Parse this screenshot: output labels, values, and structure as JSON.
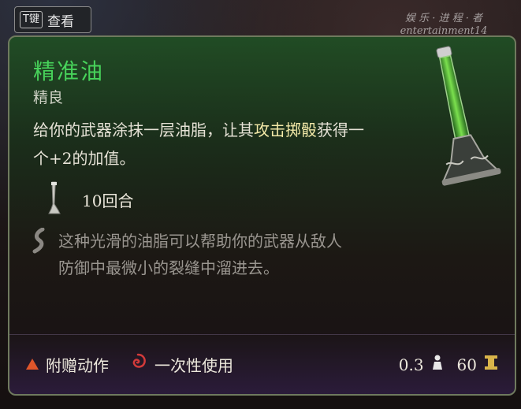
{
  "hint": {
    "key": "T键",
    "label": "查看"
  },
  "watermark": {
    "line1": "娱 乐 · 进 程 · 者",
    "line2": "entertainment14"
  },
  "item": {
    "name": "精准油",
    "rarity": "精良",
    "description_part1": "给你的武器涂抹一层油脂，让其",
    "description_highlight": "攻击掷骰",
    "description_part2": "获得一个+2的加值。",
    "duration": "10回合",
    "flavor": "这种光滑的油脂可以帮助你的武器从敌人防御中最微小的裂缝中溜进去。"
  },
  "footer": {
    "action": "附赠动作",
    "usage": "一次性使用",
    "weight": "0.3",
    "price": "60"
  },
  "colors": {
    "title": "#47d25a",
    "highlight": "#f3e9a8",
    "action_triangle": "#e0562a",
    "usage_swirl": "#d23a3a"
  },
  "icons": {
    "duration": "vial-duration-icon",
    "flavor": "flavor-quote-icon",
    "action": "bonus-action-triangle-icon",
    "usage": "single-use-swirl-icon",
    "weight": "weight-icon",
    "price": "gold-coin-icon"
  }
}
